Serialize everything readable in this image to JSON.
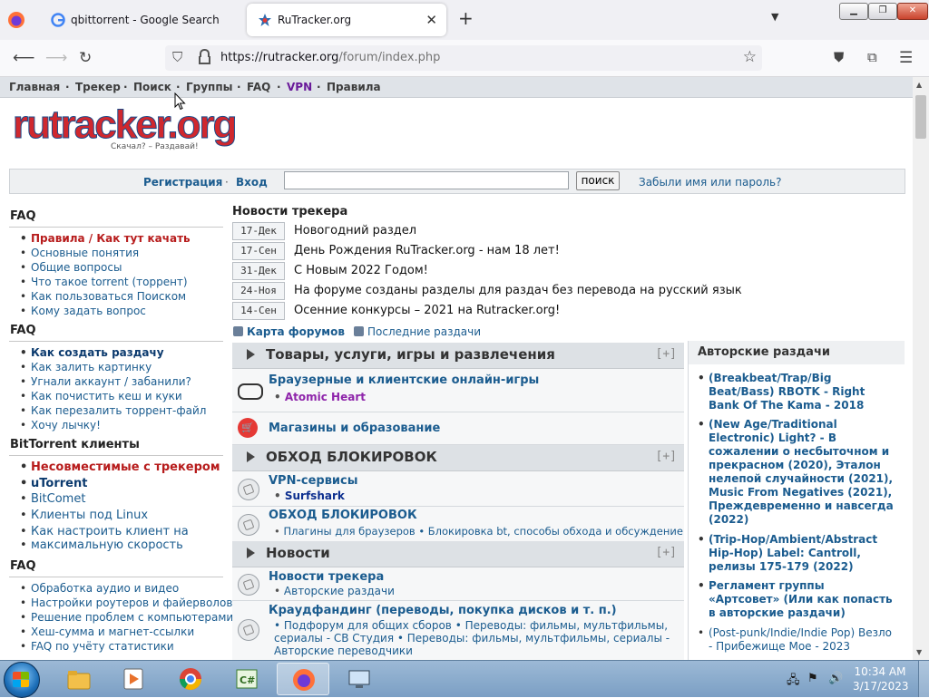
{
  "browser": {
    "tabs": [
      {
        "label": "qbittorrent - Google Search",
        "active": false
      },
      {
        "label": "RuTracker.org",
        "active": true
      }
    ],
    "new_tab_symbol": "+",
    "url_host": "https://rutracker.org",
    "url_path": "/forum/index.php"
  },
  "topnav": {
    "items": [
      "Главная",
      "Трекер",
      "Поиск",
      "Группы",
      "FAQ",
      "VPN",
      "Правила"
    ],
    "separator": "·"
  },
  "logo": {
    "text": "rutracker.org",
    "tagline": "Скачал? – Раздавай!"
  },
  "login": {
    "register": "Регистрация",
    "login": "Вход",
    "search_button": "поиск",
    "forgot": "Забыли имя или пароль?",
    "search_value": ""
  },
  "sidebar": {
    "sections": [
      {
        "title": "FAQ",
        "items": [
          "Правила / Как тут качать",
          "Основные понятия",
          "Общие вопросы",
          "Что такое torrent (торрент)",
          "Как пользоваться Поиском",
          "Кому задать вопрос"
        ]
      },
      {
        "title": "FAQ",
        "items": [
          "Как создать раздачу",
          "Как залить картинку",
          "Угнали аккаунт / забанили?",
          "Как почистить кеш и куки",
          "Как перезалить торрент-файл",
          "Хочу лычку!"
        ]
      },
      {
        "title": "BitTorrent клиенты",
        "items": [
          "Несовместимые с трекером",
          "uTorrent",
          "BitComet",
          "Клиенты под Linux",
          "Как настроить клиент на",
          "максимальную скорость"
        ]
      },
      {
        "title": "FAQ",
        "items": [
          "Обработка аудио и видео",
          "Настройки роутеров и файерволов",
          "Решение проблем с компьютерами",
          "Хеш-сумма и магнет-ссылки",
          "FAQ по учёту статистики"
        ]
      }
    ]
  },
  "news": {
    "title": "Новости трекера",
    "items": [
      {
        "date": "17-Дек",
        "text": "Новогодний раздел"
      },
      {
        "date": "17-Сен",
        "text": "День Рождения RuTracker.org - нам 18 лет!"
      },
      {
        "date": "31-Дек",
        "text": "С Новым 2022 Годом!"
      },
      {
        "date": "24-Ноя",
        "text": "На форуме созданы разделы для раздач без перевода на русский язык"
      },
      {
        "date": "14-Сен",
        "text": "Осенние конкурсы – 2021 на Rutracker.org!"
      }
    ],
    "forum_map": "Карта форумов",
    "latest": "Последние раздачи"
  },
  "forum": {
    "plus_label": "[+]",
    "categories": [
      {
        "title": "Товары, услуги, игры и развлечения",
        "forums": [
          {
            "title": "Браузерные и клиентские онлайн-игры",
            "sub": "Atomic Heart"
          },
          {
            "title": "Магазины и образование",
            "sub": ""
          }
        ]
      },
      {
        "title": "ОБХОД БЛОКИРОВОК",
        "forums": [
          {
            "title": "VPN-сервисы",
            "sub": "Surfshark"
          },
          {
            "title": "ОБХОД БЛОКИРОВОК",
            "sub": "Плагины для браузеров • Блокировка bt, способы обхода и обсуждение"
          }
        ]
      },
      {
        "title": "Новости",
        "forums": [
          {
            "title": "Новости трекера",
            "sub": "Авторские раздачи"
          },
          {
            "title": "Краудфандинг (переводы, покупка дисков и т. п.)",
            "sub": "• Подфорум для общих сборов • Переводы: фильмы, мультфильмы, сериалы - СВ Студия • Переводы: фильмы, мультфильмы, сериалы - Авторские переводчики"
          }
        ]
      }
    ]
  },
  "author_box": {
    "title": "Авторские раздачи",
    "items": [
      "(Breakbeat/Trap/Big Beat/Bass) RBOTK - Right Bank Of The Kama - 2018",
      "(New Age/Traditional Electronic) Light? - В сожалении о несбыточном и прекрасном (2020), Эталон нелепой случайности (2021), Music From Negatives (2021), Преждевременно и навсегда (2022)",
      "(Trip-Hop/Ambient/Abstract Hip-Hop) Label: Cantroll, релизы 175-179 (2022)",
      "Регламент группы «Артсовет» (Или как попасть в авторские раздачи)",
      "(Post-punk/Indie/Indie Pop) Везло - Прибежище Мое - 2023"
    ]
  },
  "taskbar": {
    "time": "10:34 AM",
    "date": "3/17/2023",
    "apps": [
      "explorer",
      "media-player",
      "chrome",
      "csharp-editor",
      "firefox",
      "remote-desktop"
    ]
  },
  "colors": {
    "link": "#1b5c8f",
    "rule_red": "#b71c1c",
    "vpn_purple": "#6a1b9a",
    "accent_purple": "#8e24aa"
  }
}
